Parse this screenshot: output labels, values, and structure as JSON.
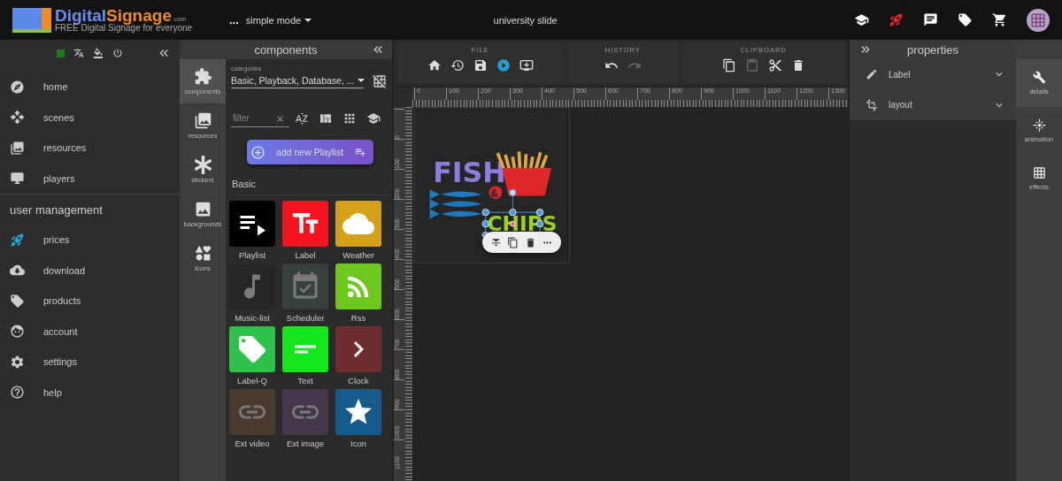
{
  "header": {
    "brand_first": "Digital",
    "brand_second": "Signage",
    "domain": ".com",
    "tagline": "FREE Digital Signage for everyone",
    "menu_dots": "...",
    "mode": "simple mode",
    "title": "university slide"
  },
  "sidebar": {
    "connected": true,
    "nav": [
      {
        "label": "home"
      },
      {
        "label": "scenes"
      },
      {
        "label": "resources"
      },
      {
        "label": "players"
      }
    ],
    "section": "user management",
    "user_nav": [
      {
        "label": "prices"
      },
      {
        "label": "download"
      },
      {
        "label": "products"
      },
      {
        "label": "account"
      },
      {
        "label": "settings"
      },
      {
        "label": "help"
      }
    ]
  },
  "components": {
    "title": "components",
    "tabs": [
      {
        "label": "components",
        "selected": true
      },
      {
        "label": "resources",
        "selected": false
      },
      {
        "label": "stickers",
        "selected": false
      },
      {
        "label": "backgrounds",
        "selected": false
      },
      {
        "label": "icons",
        "selected": false
      }
    ],
    "categories_label": "categories",
    "categories_value": "Basic, Playback, Database, ...",
    "filter_placeholder": "filter",
    "add_button": "add new Playlist",
    "group": "Basic",
    "items": [
      {
        "label": "Playlist",
        "color": "#000000",
        "disabled": false
      },
      {
        "label": "Label",
        "color": "#f5141e",
        "disabled": false
      },
      {
        "label": "Weather",
        "color": "#d4a017",
        "disabled": false
      },
      {
        "label": "Music-list",
        "color": "#262626",
        "disabled": true
      },
      {
        "label": "Scheduler",
        "color": "#37423d",
        "disabled": true
      },
      {
        "label": "Rss",
        "color": "#6cc91c",
        "disabled": false
      },
      {
        "label": "Label-Q",
        "color": "#2ec24a",
        "disabled": false
      },
      {
        "label": "Text",
        "color": "#14e61e",
        "disabled": false
      },
      {
        "label": "Clock",
        "color": "#6e2e2e",
        "disabled": false
      },
      {
        "label": "Ext video",
        "color": "#4a3a2e",
        "disabled": true
      },
      {
        "label": "Ext image",
        "color": "#45364a",
        "disabled": true
      },
      {
        "label": "Icon",
        "color": "#145a8c",
        "disabled": false
      }
    ]
  },
  "toolbar": [
    {
      "title": "FILE",
      "buttons": [
        {
          "disabled": false
        },
        {
          "disabled": false
        },
        {
          "disabled": false
        },
        {
          "disabled": false
        },
        {
          "disabled": false
        }
      ]
    },
    {
      "title": "HISTORY",
      "buttons": [
        {
          "disabled": false
        },
        {
          "disabled": true
        }
      ]
    },
    {
      "title": "CLIPBOARD",
      "buttons": [
        {
          "disabled": false
        },
        {
          "disabled": true
        },
        {
          "disabled": false
        },
        {
          "disabled": false
        }
      ]
    }
  ],
  "ruler": {
    "horizontal": [
      "0",
      "100",
      "200",
      "300",
      "400",
      "500",
      "600",
      "700",
      "800",
      "900",
      "1000",
      "1100",
      "1200",
      "1300"
    ],
    "vertical": [
      "0",
      "100",
      "200",
      "300",
      "400",
      "500",
      "600",
      "700",
      "800",
      "900",
      "1000",
      "1100"
    ]
  },
  "artwork": {
    "word_one": "FISH",
    "ampersand": "&",
    "word_two": "CHIPS",
    "selected": true
  },
  "properties": {
    "title": "properties",
    "sections": [
      {
        "label": "Label",
        "expanded": false
      },
      {
        "label": "layout",
        "expanded": false
      }
    ],
    "tabs": [
      {
        "label": "details",
        "selected": true
      },
      {
        "label": "animation",
        "selected": false
      },
      {
        "label": "effects",
        "selected": false
      }
    ]
  }
}
